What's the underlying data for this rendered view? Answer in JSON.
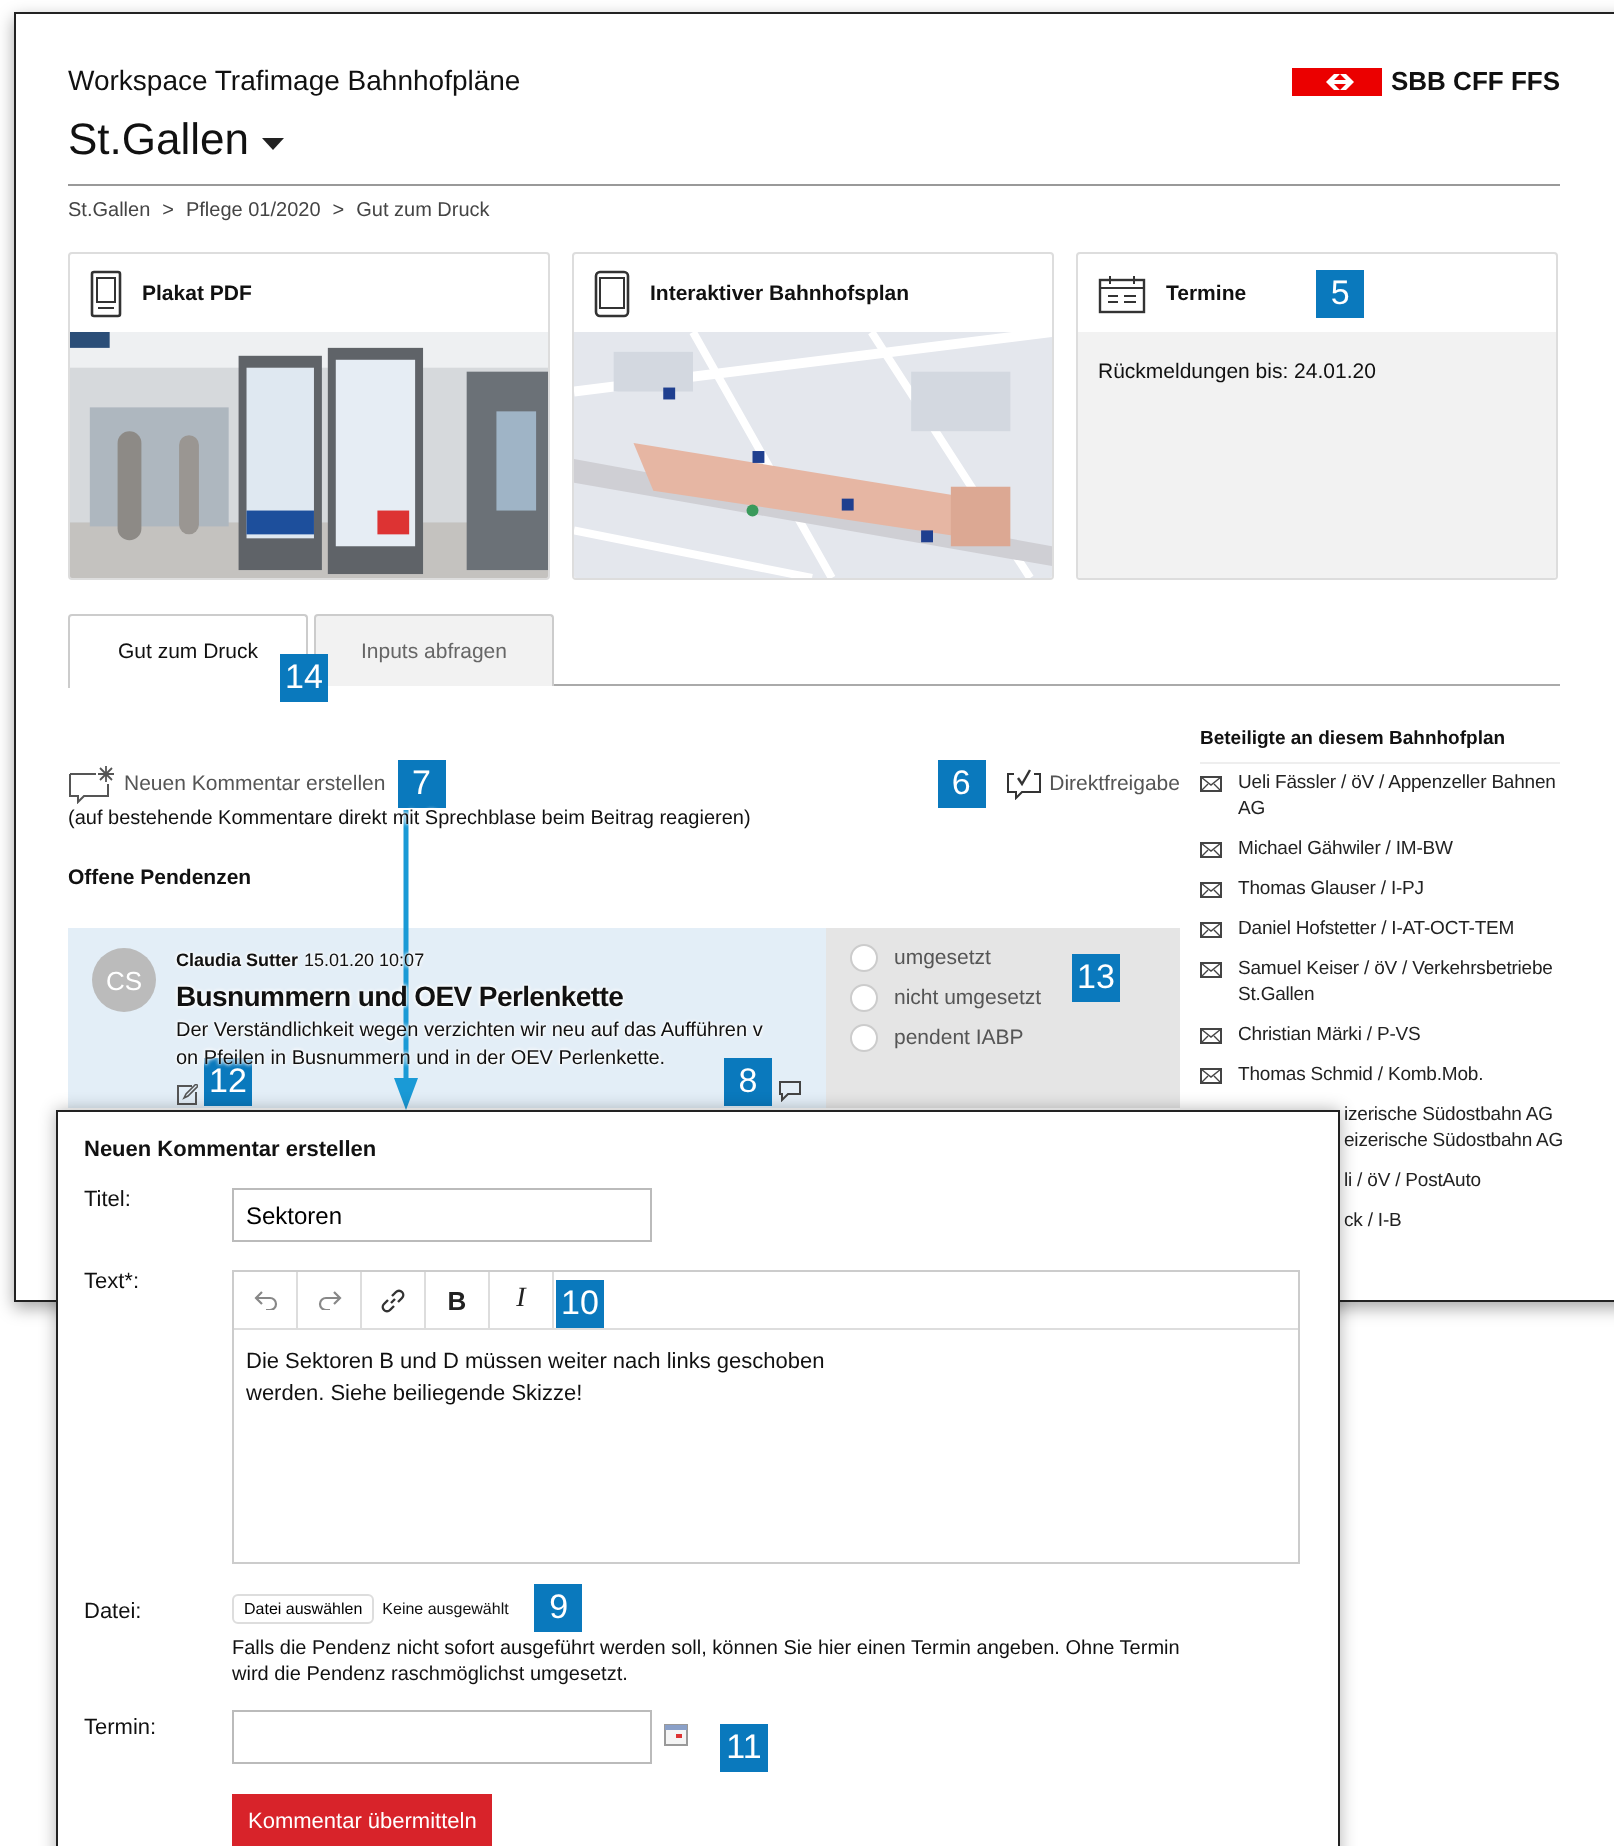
{
  "header": {
    "workspace": "Workspace Trafimage Bahnhofpläne",
    "station": "St.Gallen",
    "logo_text": "SBB CFF FFS"
  },
  "breadcrumbs": {
    "separator": ">",
    "items": [
      "St.Gallen",
      "Pflege 01/2020",
      "Gut zum Druck"
    ]
  },
  "cards": [
    {
      "title": "Plakat PDF"
    },
    {
      "kind": "map",
      "title": "Interaktiver Bahnhofsplan"
    },
    {
      "kind": "info",
      "title": "Termine",
      "badge": "5",
      "text": "Rückmeldungen bis: 24.01.20"
    }
  ],
  "tabs": [
    {
      "label": "Gut zum Druck",
      "selected": true,
      "badge": "14"
    },
    {
      "label": "Inputs abfragen",
      "selected": false
    }
  ],
  "actions": {
    "new_comment": "Neuen Kommentar erstellen",
    "new_comment_badge": "7",
    "hint": "(auf bestehende Kommentare direkt mit Sprechblase beim Beitrag reagieren)",
    "direct_release": "Direktfreigabe",
    "direct_release_badge": "6"
  },
  "section_title": "Offene Pendenzen",
  "pending": [
    {
      "initials": "CS",
      "author": "Claudia Sutter",
      "time": "15.01.20 10:07",
      "title": "Busnummern und OEV Perlenkette",
      "text": "Der Verständlichkeit wegen verzichten wir neu auf das Aufführen v\non Pfeilen in Busnummern und in der OEV Perlenkette.",
      "edit_badge": "12",
      "reply_badge": "8",
      "status_badge": "13",
      "options": [
        {
          "label": "umgesetzt",
          "selected": false
        },
        {
          "label": "nicht umgesetzt",
          "selected": false
        },
        {
          "label": "pendent IABP",
          "selected": false
        }
      ]
    }
  ],
  "participants": {
    "title": "Beteiligte an diesem Bahnhofplan",
    "items": [
      {
        "kind": "full",
        "text": "Ueli Fässler / öV / Appenzeller Bahnen AG"
      },
      {
        "kind": "full",
        "text": "Michael Gähwiler / IM-BW"
      },
      {
        "kind": "full",
        "text": "Thomas Glauser / I-PJ"
      },
      {
        "kind": "full",
        "text": "Daniel Hofstetter / I-AT-OCT-TEM"
      },
      {
        "kind": "full",
        "text": "Samuel Keiser / öV / Verkehrsbetriebe St.Gallen"
      },
      {
        "kind": "full",
        "text": "Christian Märki / P-VS"
      },
      {
        "kind": "full",
        "text": "Thomas Schmid / Komb.Mob."
      },
      {
        "kind": "partial",
        "text": "izerische Südostbahn AG\neizerische Südostbahn AG"
      },
      {
        "kind": "partial",
        "text": "li / öV / PostAuto"
      },
      {
        "kind": "partial",
        "text": "ck / I-B"
      }
    ]
  },
  "dialog": {
    "title": "Neuen Kommentar erstellen",
    "title_label": "Titel:",
    "title_value": "Sektoren",
    "text_label": "Text*:",
    "toolbar": [
      {
        "kind": "undo"
      },
      {
        "kind": "redo"
      },
      {
        "kind": "link"
      },
      {
        "kind": "bold",
        "label": "B"
      },
      {
        "kind": "italic",
        "label": "I"
      }
    ],
    "toolbar_badge": "10",
    "text_value": "Die Sektoren B und D müssen weiter nach links geschoben\nwerden. Siehe beiliegende Skizze!",
    "file_label": "Datei:",
    "file_button": "Datei auswählen",
    "file_status": "Keine ausgewählt",
    "file_badge": "9",
    "date_hint": "Falls die Pendenz nicht sofort ausgeführt werden soll, können Sie hier einen Termin angeben. Ohne Termin\nwird die Pendenz raschmöglichst umgesetzt.",
    "date_label": "Termin:",
    "date_badge": "11",
    "submit": "Kommentar übermitteln"
  }
}
